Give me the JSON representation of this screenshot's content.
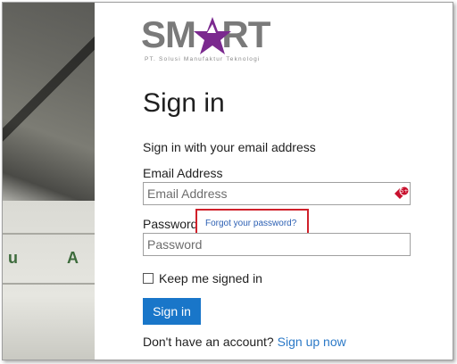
{
  "brand": {
    "logo_text": "SMART",
    "tagline": "PT. Solusi Manufaktur Teknologi",
    "accent_color": "#7b2a8f",
    "logo_gray": "#7a7a7a"
  },
  "heading": "Sign in",
  "intro": "Sign in with your email address",
  "email": {
    "label": "Email Address",
    "placeholder": "Email Address",
    "value": "",
    "icon": "password-manager-icon"
  },
  "password": {
    "label": "Password",
    "placeholder": "Password",
    "value": ""
  },
  "forgot_link": "Forgot your password?",
  "highlight_color": "#d0202a",
  "keep_signed_in": {
    "label": "Keep me signed in",
    "checked": false
  },
  "signin_button": "Sign in",
  "button_color": "#1976c9",
  "signup": {
    "prompt": "Don't have an account?",
    "link": "Sign up now"
  }
}
